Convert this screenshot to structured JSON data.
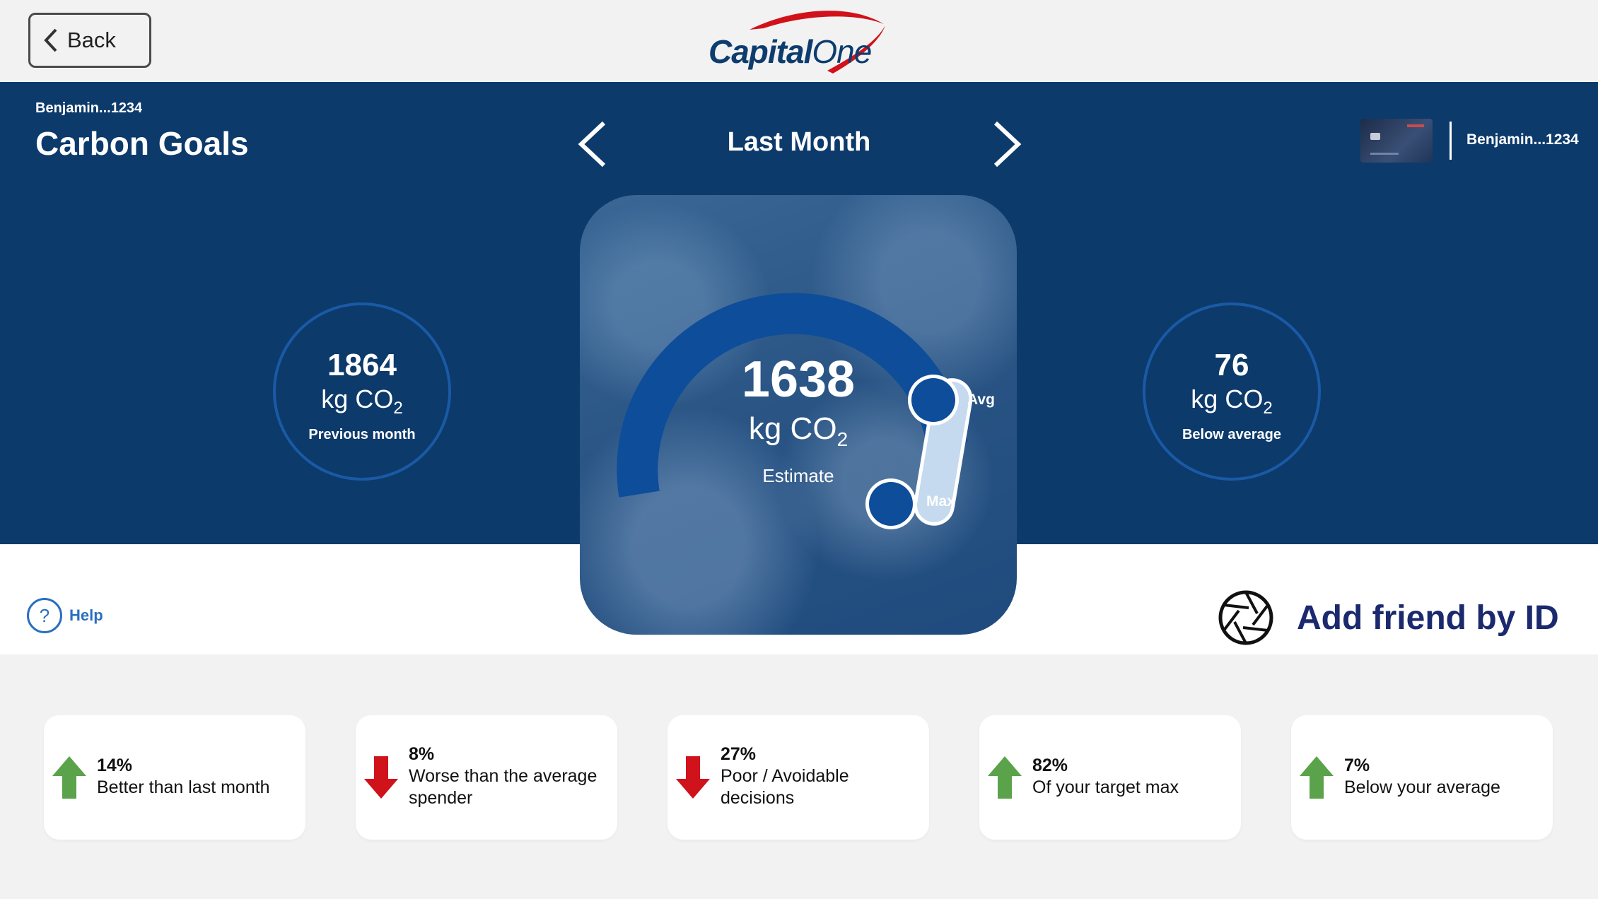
{
  "header": {
    "back_label": "Back",
    "logo_text_capital": "Capital",
    "logo_text_one": "One"
  },
  "hero": {
    "user": "Benjamin...1234",
    "title": "Carbon Goals",
    "period": "Last Month",
    "card_user": "Benjamin...1234"
  },
  "stats": {
    "previous": {
      "value": "1864",
      "unit": "kg CO",
      "sub": "2",
      "label": "Previous month"
    },
    "estimate": {
      "value": "1638",
      "unit": "kg CO",
      "sub": "2",
      "label": "Estimate",
      "avg_label": "Avg",
      "max_label": "Max"
    },
    "below": {
      "value": "76",
      "unit": "kg CO",
      "sub": "2",
      "label": "Below average"
    }
  },
  "help": {
    "label": "Help",
    "icon": "?"
  },
  "add_friend": {
    "label": "Add friend by ID"
  },
  "insights": [
    {
      "pct": "14%",
      "text": "Better than last month",
      "direction": "up"
    },
    {
      "pct": "8%",
      "text": "Worse than the average spender",
      "direction": "down"
    },
    {
      "pct": "27%",
      "text": "Poor / Avoidable decisions",
      "direction": "down"
    },
    {
      "pct": "82%",
      "text": "Of your target max",
      "direction": "up"
    },
    {
      "pct": "7%",
      "text": "Below your average",
      "direction": "up"
    }
  ],
  "colors": {
    "hero_bg": "#0c3a6b",
    "up_arrow": "#5aa34a",
    "down_arrow": "#d0121b",
    "accent_blue": "#2a6fbf"
  }
}
